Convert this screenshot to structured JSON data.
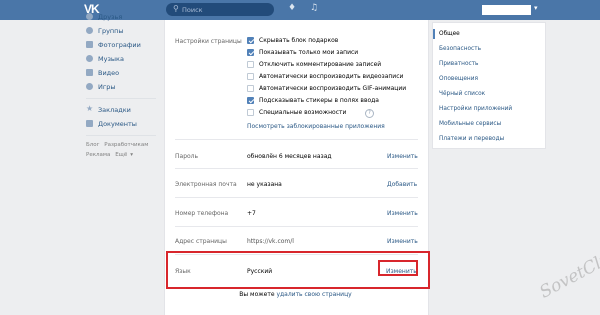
{
  "header": {
    "logo": "VK",
    "search_placeholder": "Поиск",
    "search_icon": "search-icon",
    "notify_icon": "bell-icon",
    "music_icon": "music-note-icon"
  },
  "leftnav": {
    "items": [
      {
        "label": "Друзья",
        "icon": "friends-icon"
      },
      {
        "label": "Группы",
        "icon": "groups-icon"
      },
      {
        "label": "Фотографии",
        "icon": "photo-icon"
      },
      {
        "label": "Музыка",
        "icon": "music-icon"
      },
      {
        "label": "Видео",
        "icon": "video-icon"
      },
      {
        "label": "Игры",
        "icon": "games-icon"
      }
    ],
    "items2": [
      {
        "label": "Закладки",
        "icon": "star-icon"
      },
      {
        "label": "Документы",
        "icon": "docs-icon"
      }
    ],
    "footer": {
      "blog": "Блог",
      "dev": "Разработчикам",
      "ads": "Реклама",
      "more": "Ещё"
    }
  },
  "settings": {
    "page_settings_label": "Настройки страницы",
    "checkboxes": [
      {
        "label": "Скрывать блок подарков",
        "checked": true
      },
      {
        "label": "Показывать только мои записи",
        "checked": true
      },
      {
        "label": "Отключить комментирование записей",
        "checked": false
      },
      {
        "label": "Автоматически воспроизводить видеозаписи",
        "checked": false
      },
      {
        "label": "Автоматически воспроизводить GIF-анимации",
        "checked": false
      },
      {
        "label": "Подсказывать стикеры в полях ввода",
        "checked": true
      },
      {
        "label": "Специальные возможности",
        "checked": false
      }
    ],
    "help_mark": "?",
    "blocked_apps_link": "Посмотреть заблокированные приложения",
    "password": {
      "label": "Пароль",
      "value": "обновлён 6 месяцев назад",
      "action": "Изменить"
    },
    "email": {
      "label": "Электронная почта",
      "value": "не указана",
      "action": "Добавить"
    },
    "phone": {
      "label": "Номер телефона",
      "value": "+7",
      "action": "Изменить"
    },
    "address": {
      "label": "Адрес страницы",
      "value": "https://vk.com/l",
      "action": "Изменить"
    },
    "language": {
      "label": "Язык",
      "value": "Русский",
      "action": "Изменить"
    },
    "delete_prefix": "Вы можете",
    "delete_link": "удалить свою страницу"
  },
  "rightnav": {
    "items": [
      {
        "label": "Общее",
        "active": true
      },
      {
        "label": "Безопасность",
        "active": false
      },
      {
        "label": "Приватность",
        "active": false
      },
      {
        "label": "Оповещения",
        "active": false
      },
      {
        "label": "Чёрный список",
        "active": false
      },
      {
        "label": "Настройки приложений",
        "active": false
      },
      {
        "label": "Мобильные сервисы",
        "active": false
      },
      {
        "label": "Платежи и переводы",
        "active": false
      }
    ]
  },
  "watermark": "SovetClub",
  "colors": {
    "header": "#4a76a8",
    "accent": "#5181b8",
    "link": "#2a5885",
    "highlight": "#d8262c"
  }
}
